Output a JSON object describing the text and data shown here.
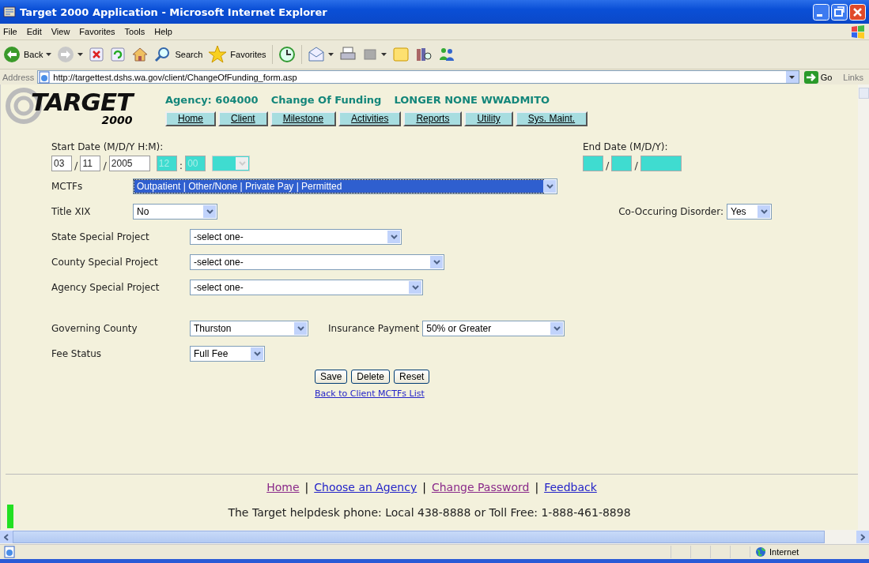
{
  "window": {
    "title": "Target 2000 Application - Microsoft Internet Explorer"
  },
  "menu": [
    "File",
    "Edit",
    "View",
    "Favorites",
    "Tools",
    "Help"
  ],
  "toolbar": [
    {
      "kind": "back",
      "label": "Back",
      "menu": true
    },
    {
      "kind": "forward",
      "menu": true
    },
    {
      "kind": "stop"
    },
    {
      "kind": "refresh"
    },
    {
      "kind": "home"
    },
    {
      "kind": "search",
      "label": "Search"
    },
    {
      "kind": "favorites",
      "label": "Favorites"
    },
    {
      "kind": "history"
    },
    {
      "kind": "mail",
      "menu": true
    },
    {
      "kind": "print"
    },
    {
      "kind": "edit",
      "menu": true
    },
    {
      "kind": "discuss"
    },
    {
      "kind": "research"
    },
    {
      "kind": "messenger"
    }
  ],
  "address": {
    "label": "Address",
    "url": "http://targettest.dshs.wa.gov/client/ChangeOfFunding_form.asp",
    "go": "Go",
    "links": "Links"
  },
  "header": {
    "logo": "TARGET",
    "logo_sub": "2000",
    "agency": "Agency: 604000",
    "page": "Change Of Funding",
    "client": "LONGER NONE WWADMITO"
  },
  "nav": [
    "Home",
    "Client",
    "Milestone",
    "Activities",
    "Reports",
    "Utility",
    "Sys. Maint."
  ],
  "start_date": {
    "label": "Start Date (M/D/Y H:M):",
    "parts": [
      {
        "kind": "input",
        "value": "03",
        "disabled": false
      },
      {
        "kind": "sep",
        "text": "/"
      },
      {
        "kind": "input",
        "value": "11",
        "disabled": false
      },
      {
        "kind": "sep",
        "text": "/"
      },
      {
        "kind": "input",
        "value": "2005",
        "disabled": false,
        "wide": true
      },
      {
        "kind": "input",
        "value": "12",
        "disabled": true
      },
      {
        "kind": "sep",
        "text": ":"
      },
      {
        "kind": "input",
        "value": "00",
        "disabled": true
      },
      {
        "kind": "select",
        "disabled": true
      }
    ]
  },
  "end_date": {
    "label": "End Date (M/D/Y):",
    "parts": [
      {
        "kind": "input",
        "disabled": true
      },
      {
        "kind": "sep",
        "text": "/"
      },
      {
        "kind": "input",
        "disabled": true
      },
      {
        "kind": "sep",
        "text": "/"
      },
      {
        "kind": "input",
        "disabled": true,
        "wide": true
      }
    ]
  },
  "mctfs": {
    "label": "MCTFs",
    "value": "Outpatient | Other/None | Private Pay | Permitted",
    "focused": true
  },
  "title_xix": {
    "label": "Title XIX",
    "value": "No",
    "focused": false
  },
  "co_occurring": {
    "label": "Co-Occuring Disorder:",
    "value": "Yes",
    "focused": false
  },
  "projects": [
    {
      "label": "State Special Project",
      "value": "-select one-",
      "focused": false
    },
    {
      "label": "County Special Project",
      "value": "-select one-",
      "focused": false
    },
    {
      "label": "Agency Special Project",
      "value": "-select one-",
      "focused": false
    }
  ],
  "governing_county": {
    "label": "Governing County",
    "value": "Thurston",
    "focused": false
  },
  "insurance_payment": {
    "label": "Insurance Payment",
    "value": "50% or Greater",
    "focused": false
  },
  "fee_status": {
    "label": "Fee Status",
    "value": "Full Fee",
    "focused": false
  },
  "buttons": [
    "Save",
    "Delete",
    "Reset"
  ],
  "back_link": "Back to Client MCTFs List",
  "footer": {
    "links": [
      {
        "kind": "link",
        "text": "Home",
        "visited": true
      },
      {
        "kind": "sep",
        "text": "|"
      },
      {
        "kind": "link",
        "text": "Choose an Agency",
        "visited": false
      },
      {
        "kind": "sep",
        "text": "|"
      },
      {
        "kind": "link",
        "text": "Change Password",
        "visited": true
      },
      {
        "kind": "sep",
        "text": "|"
      },
      {
        "kind": "link",
        "text": "Feedback",
        "visited": false
      }
    ],
    "phone": "The Target helpdesk phone: Local 438-8888 or Toll Free: 1-888-461-8898"
  },
  "status_bar": {
    "zone": "Internet"
  }
}
